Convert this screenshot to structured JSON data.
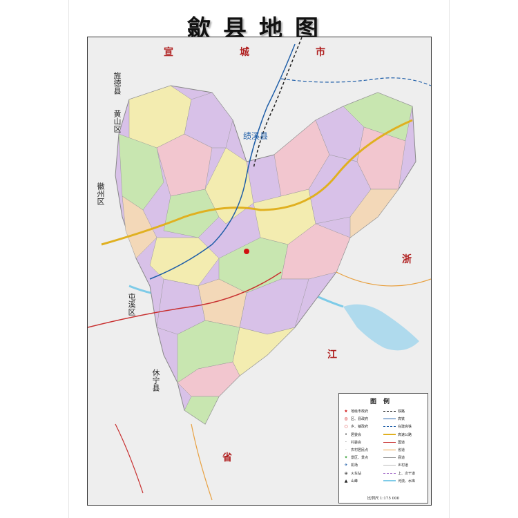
{
  "title": "歙县地图",
  "regions": {
    "xuancheng": "宣城市",
    "jixi": "绩溪县",
    "huizhou": "徽州区",
    "tunxi": "屯溪区",
    "huangshan": "黄山区",
    "jingde": "旌德县",
    "xiuning": "休宁县",
    "zhejiang": "浙江省"
  },
  "legend": {
    "title": "图例",
    "left_items": [
      {
        "icon": "star-icon",
        "symbol": "★",
        "color": "#d01010",
        "label": "地级市政府"
      },
      {
        "icon": "circle-dot-icon",
        "symbol": "◎",
        "color": "#d01010",
        "label": "区、县政府"
      },
      {
        "icon": "circle-icon",
        "symbol": "○",
        "color": "#d01010",
        "label": "乡、镇政府"
      },
      {
        "icon": "dot-icon",
        "symbol": "•",
        "color": "#333333",
        "label": "居委会"
      },
      {
        "icon": "small-dot-icon",
        "symbol": "·",
        "color": "#333333",
        "label": "村委会"
      },
      {
        "icon": "tiny-dot-icon",
        "symbol": "·",
        "color": "#777777",
        "label": "农村居民点"
      },
      {
        "icon": "scenic-icon",
        "symbol": "✦",
        "color": "#2a9a2a",
        "label": "景区、景点"
      },
      {
        "icon": "airport-icon",
        "symbol": "✈",
        "color": "#1f5ea8",
        "label": "机场"
      },
      {
        "icon": "train-station-icon",
        "symbol": "⊕",
        "color": "#333333",
        "label": "火车站"
      },
      {
        "icon": "mountain-icon",
        "symbol": "▲",
        "color": "#222222",
        "label": "山峰"
      }
    ],
    "right_items": [
      {
        "icon": "railway-icon",
        "color": "#222222",
        "style": "dashed",
        "label": "铁路"
      },
      {
        "icon": "high-speed-rail-icon",
        "color": "#1f5ea8",
        "style": "solid",
        "label": "高铁"
      },
      {
        "icon": "planned-rail-icon",
        "color": "#1f5ea8",
        "style": "dashed",
        "label": "在建高铁"
      },
      {
        "icon": "expressway-icon",
        "color": "#e0b020",
        "style": "solid",
        "label": "高速公路"
      },
      {
        "icon": "national-road-icon",
        "color": "#c83030",
        "style": "solid",
        "label": "国道"
      },
      {
        "icon": "provincial-road-icon",
        "color": "#e8a040",
        "style": "solid",
        "label": "省道"
      },
      {
        "icon": "county-road-icon",
        "color": "#999999",
        "style": "solid",
        "label": "县道"
      },
      {
        "icon": "township-road-icon",
        "color": "#bbbbbb",
        "style": "solid",
        "label": "乡村道"
      },
      {
        "icon": "boundary-icon",
        "color": "#aa77cc",
        "style": "dashed",
        "label": "上、次干道"
      },
      {
        "icon": "water-icon",
        "color": "#7ecbe8",
        "style": "solid",
        "label": "河流、水库"
      }
    ],
    "scale": "比例尺 1:175 000"
  },
  "colors": {
    "background": "#eeeeee",
    "purple": "#d8c1e8",
    "pink": "#f2c6cf",
    "green": "#c8e6b0",
    "yellow": "#f3ecb0",
    "peach": "#f3d8b8",
    "water": "#9fd4ec",
    "rail": "#1f5ea8",
    "expressway": "#e0b020"
  }
}
